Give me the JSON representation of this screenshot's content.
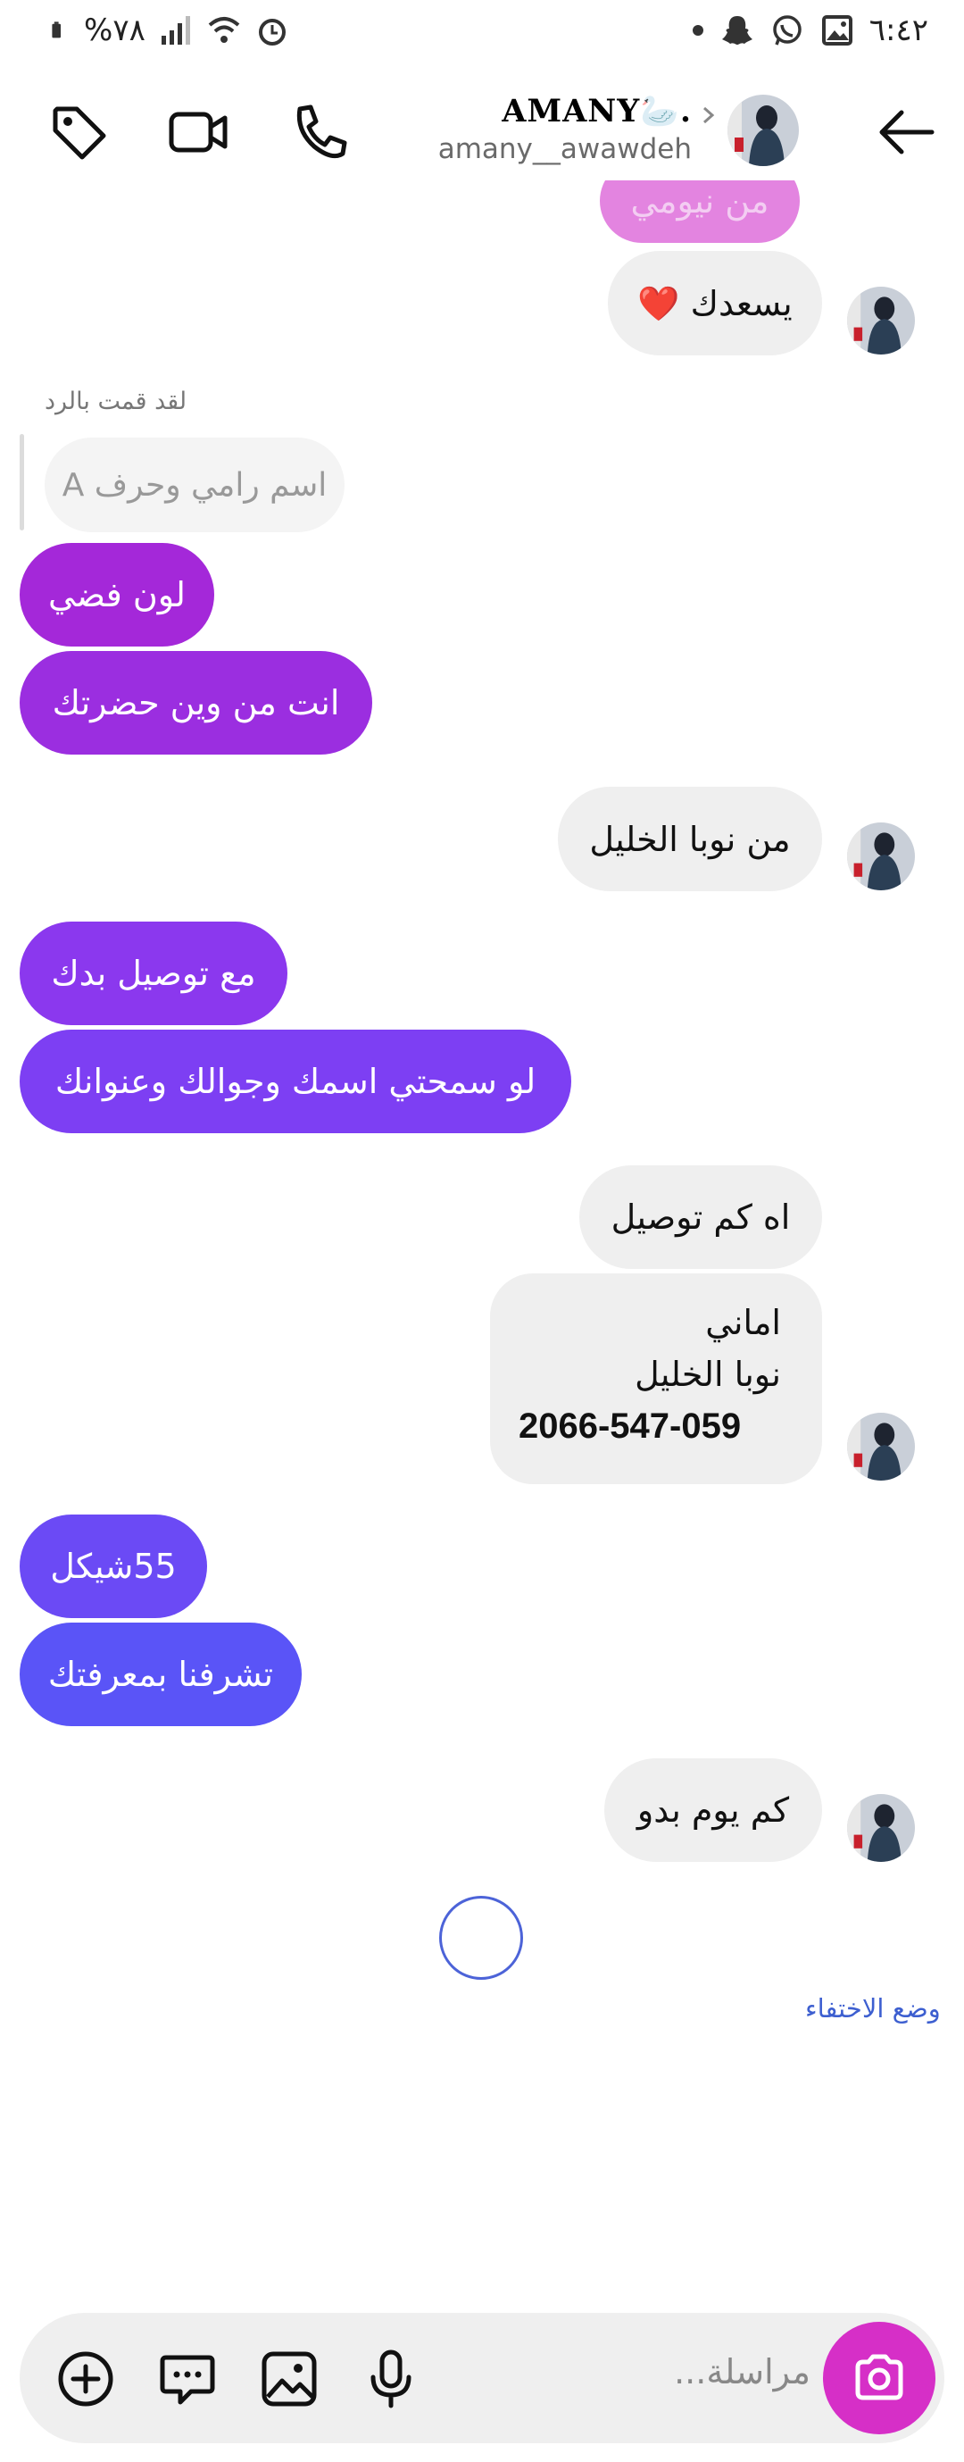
{
  "status_bar": {
    "battery_text": "%٧٨",
    "time": "٦:٤٢"
  },
  "header": {
    "name": "AMANY🦢.",
    "username": "amany__awawdeh"
  },
  "colors": {
    "sent_gradient_top": "#a428d9",
    "sent_gradient_bottom": "#5a54f7",
    "received": "#efefef",
    "camera_button": "#d62fc7",
    "link": "#3d5fd0"
  },
  "messages": {
    "partial_top": "من نيومي",
    "m1": "يسعدك ❤️",
    "reply_note": "لقد قمت بالرد",
    "reply_quote": "اسم رامي وحرف A",
    "m2": "لون فضي",
    "m3": "انت من وين حضرتك",
    "m4": "من نوبا الخليل",
    "m5": "مع توصيل بدك",
    "m6": "لو سمحتي اسمك وجوالك وعنوانك",
    "m7": "اه كم توصيل",
    "m8_line1": "اماني",
    "m8_line2": "نوبا الخليل",
    "m8_line3": "2066-547-059",
    "m9": "55شيكل",
    "m10": "تشرفنا بمعرفتك",
    "m11": "كم يوم بدو"
  },
  "vanish_mode_link": "وضع الاختفاء",
  "composer": {
    "placeholder": "مراسلة..."
  }
}
